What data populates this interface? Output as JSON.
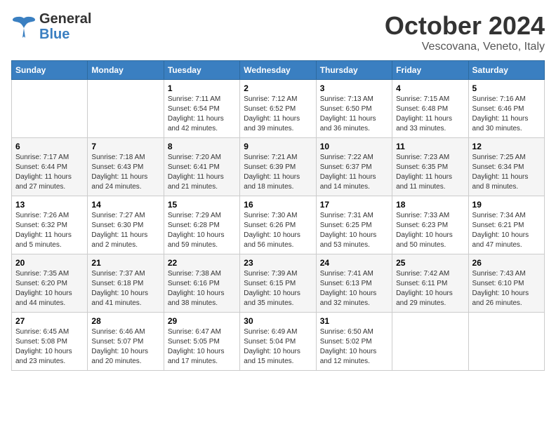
{
  "header": {
    "logo_general": "General",
    "logo_blue": "Blue",
    "month": "October 2024",
    "location": "Vescovana, Veneto, Italy"
  },
  "weekdays": [
    "Sunday",
    "Monday",
    "Tuesday",
    "Wednesday",
    "Thursday",
    "Friday",
    "Saturday"
  ],
  "weeks": [
    [
      {
        "day": "",
        "sunrise": "",
        "sunset": "",
        "daylight": ""
      },
      {
        "day": "",
        "sunrise": "",
        "sunset": "",
        "daylight": ""
      },
      {
        "day": "1",
        "sunrise": "Sunrise: 7:11 AM",
        "sunset": "Sunset: 6:54 PM",
        "daylight": "Daylight: 11 hours and 42 minutes."
      },
      {
        "day": "2",
        "sunrise": "Sunrise: 7:12 AM",
        "sunset": "Sunset: 6:52 PM",
        "daylight": "Daylight: 11 hours and 39 minutes."
      },
      {
        "day": "3",
        "sunrise": "Sunrise: 7:13 AM",
        "sunset": "Sunset: 6:50 PM",
        "daylight": "Daylight: 11 hours and 36 minutes."
      },
      {
        "day": "4",
        "sunrise": "Sunrise: 7:15 AM",
        "sunset": "Sunset: 6:48 PM",
        "daylight": "Daylight: 11 hours and 33 minutes."
      },
      {
        "day": "5",
        "sunrise": "Sunrise: 7:16 AM",
        "sunset": "Sunset: 6:46 PM",
        "daylight": "Daylight: 11 hours and 30 minutes."
      }
    ],
    [
      {
        "day": "6",
        "sunrise": "Sunrise: 7:17 AM",
        "sunset": "Sunset: 6:44 PM",
        "daylight": "Daylight: 11 hours and 27 minutes."
      },
      {
        "day": "7",
        "sunrise": "Sunrise: 7:18 AM",
        "sunset": "Sunset: 6:43 PM",
        "daylight": "Daylight: 11 hours and 24 minutes."
      },
      {
        "day": "8",
        "sunrise": "Sunrise: 7:20 AM",
        "sunset": "Sunset: 6:41 PM",
        "daylight": "Daylight: 11 hours and 21 minutes."
      },
      {
        "day": "9",
        "sunrise": "Sunrise: 7:21 AM",
        "sunset": "Sunset: 6:39 PM",
        "daylight": "Daylight: 11 hours and 18 minutes."
      },
      {
        "day": "10",
        "sunrise": "Sunrise: 7:22 AM",
        "sunset": "Sunset: 6:37 PM",
        "daylight": "Daylight: 11 hours and 14 minutes."
      },
      {
        "day": "11",
        "sunrise": "Sunrise: 7:23 AM",
        "sunset": "Sunset: 6:35 PM",
        "daylight": "Daylight: 11 hours and 11 minutes."
      },
      {
        "day": "12",
        "sunrise": "Sunrise: 7:25 AM",
        "sunset": "Sunset: 6:34 PM",
        "daylight": "Daylight: 11 hours and 8 minutes."
      }
    ],
    [
      {
        "day": "13",
        "sunrise": "Sunrise: 7:26 AM",
        "sunset": "Sunset: 6:32 PM",
        "daylight": "Daylight: 11 hours and 5 minutes."
      },
      {
        "day": "14",
        "sunrise": "Sunrise: 7:27 AM",
        "sunset": "Sunset: 6:30 PM",
        "daylight": "Daylight: 11 hours and 2 minutes."
      },
      {
        "day": "15",
        "sunrise": "Sunrise: 7:29 AM",
        "sunset": "Sunset: 6:28 PM",
        "daylight": "Daylight: 10 hours and 59 minutes."
      },
      {
        "day": "16",
        "sunrise": "Sunrise: 7:30 AM",
        "sunset": "Sunset: 6:26 PM",
        "daylight": "Daylight: 10 hours and 56 minutes."
      },
      {
        "day": "17",
        "sunrise": "Sunrise: 7:31 AM",
        "sunset": "Sunset: 6:25 PM",
        "daylight": "Daylight: 10 hours and 53 minutes."
      },
      {
        "day": "18",
        "sunrise": "Sunrise: 7:33 AM",
        "sunset": "Sunset: 6:23 PM",
        "daylight": "Daylight: 10 hours and 50 minutes."
      },
      {
        "day": "19",
        "sunrise": "Sunrise: 7:34 AM",
        "sunset": "Sunset: 6:21 PM",
        "daylight": "Daylight: 10 hours and 47 minutes."
      }
    ],
    [
      {
        "day": "20",
        "sunrise": "Sunrise: 7:35 AM",
        "sunset": "Sunset: 6:20 PM",
        "daylight": "Daylight: 10 hours and 44 minutes."
      },
      {
        "day": "21",
        "sunrise": "Sunrise: 7:37 AM",
        "sunset": "Sunset: 6:18 PM",
        "daylight": "Daylight: 10 hours and 41 minutes."
      },
      {
        "day": "22",
        "sunrise": "Sunrise: 7:38 AM",
        "sunset": "Sunset: 6:16 PM",
        "daylight": "Daylight: 10 hours and 38 minutes."
      },
      {
        "day": "23",
        "sunrise": "Sunrise: 7:39 AM",
        "sunset": "Sunset: 6:15 PM",
        "daylight": "Daylight: 10 hours and 35 minutes."
      },
      {
        "day": "24",
        "sunrise": "Sunrise: 7:41 AM",
        "sunset": "Sunset: 6:13 PM",
        "daylight": "Daylight: 10 hours and 32 minutes."
      },
      {
        "day": "25",
        "sunrise": "Sunrise: 7:42 AM",
        "sunset": "Sunset: 6:11 PM",
        "daylight": "Daylight: 10 hours and 29 minutes."
      },
      {
        "day": "26",
        "sunrise": "Sunrise: 7:43 AM",
        "sunset": "Sunset: 6:10 PM",
        "daylight": "Daylight: 10 hours and 26 minutes."
      }
    ],
    [
      {
        "day": "27",
        "sunrise": "Sunrise: 6:45 AM",
        "sunset": "Sunset: 5:08 PM",
        "daylight": "Daylight: 10 hours and 23 minutes."
      },
      {
        "day": "28",
        "sunrise": "Sunrise: 6:46 AM",
        "sunset": "Sunset: 5:07 PM",
        "daylight": "Daylight: 10 hours and 20 minutes."
      },
      {
        "day": "29",
        "sunrise": "Sunrise: 6:47 AM",
        "sunset": "Sunset: 5:05 PM",
        "daylight": "Daylight: 10 hours and 17 minutes."
      },
      {
        "day": "30",
        "sunrise": "Sunrise: 6:49 AM",
        "sunset": "Sunset: 5:04 PM",
        "daylight": "Daylight: 10 hours and 15 minutes."
      },
      {
        "day": "31",
        "sunrise": "Sunrise: 6:50 AM",
        "sunset": "Sunset: 5:02 PM",
        "daylight": "Daylight: 10 hours and 12 minutes."
      },
      {
        "day": "",
        "sunrise": "",
        "sunset": "",
        "daylight": ""
      },
      {
        "day": "",
        "sunrise": "",
        "sunset": "",
        "daylight": ""
      }
    ]
  ]
}
